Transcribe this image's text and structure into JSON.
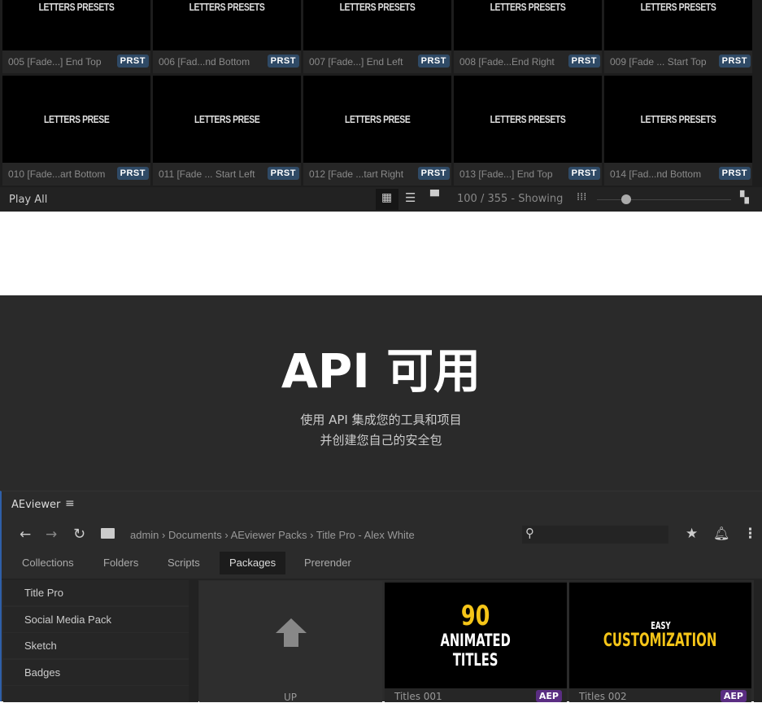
{
  "grid": {
    "rows": [
      [
        {
          "label": "005 [Fade...] End Top",
          "thumb": "LETTERS PRESETS"
        },
        {
          "label": "006 [Fad...nd Bottom",
          "thumb": "LETTERS PRESETS"
        },
        {
          "label": "007 [Fade...] End Left",
          "thumb": "LETTERS PRESETS"
        },
        {
          "label": "008 [Fade...End Right",
          "thumb": "LETTERS PRESETS"
        },
        {
          "label": "009 [Fade ... Start Top",
          "thumb": "LETTERS PRESETS"
        }
      ],
      [
        {
          "label": "010 [Fade...art Bottom",
          "thumb": "LETTERS PRESE"
        },
        {
          "label": "011 [Fade ... Start Left",
          "thumb": "LETTERS PRESE"
        },
        {
          "label": "012 [Fade ...tart Right",
          "thumb": "LETTERS PRESE"
        },
        {
          "label": "013 [Fade...] End Top",
          "thumb": "LETTERS PRESETS"
        },
        {
          "label": "014 [Fad...nd Bottom",
          "thumb": "LETTERS PRESETS"
        }
      ]
    ],
    "badge": "PRST"
  },
  "bottom_bar": {
    "play_all": "Play All",
    "showing": "100 / 355 - Showing",
    "zoom_fraction": 0.22
  },
  "promo": {
    "title": "API 可用",
    "line1": "使用 API 集成您的工具和项目",
    "line2": "并创建您自己的安全包"
  },
  "app": {
    "title": "AEviewer",
    "breadcrumb": [
      "admin",
      "Documents",
      "AEviewer Packs",
      "Title Pro - Alex White"
    ],
    "tabs": [
      "Collections",
      "Folders",
      "Scripts",
      "Packages",
      "Prerender"
    ],
    "active_tab": "Packages",
    "sidebar": [
      "Title Pro",
      "Social Media Pack",
      "Sketch",
      "Badges"
    ],
    "up_label": "UP",
    "items": [
      {
        "label": "Titles 001",
        "badge": "AEP",
        "thumb_top": "90",
        "thumb_mid": "ANIMATED",
        "thumb_bot": "TITLES"
      },
      {
        "label": "Titles 002",
        "badge": "AEP",
        "thumb_top": "EASY",
        "thumb_mid": "CUSTOMIZATION"
      }
    ]
  },
  "colors": {
    "badge": "#2f4a66",
    "aep": "#5a2d82",
    "accent": "#f5c518"
  }
}
